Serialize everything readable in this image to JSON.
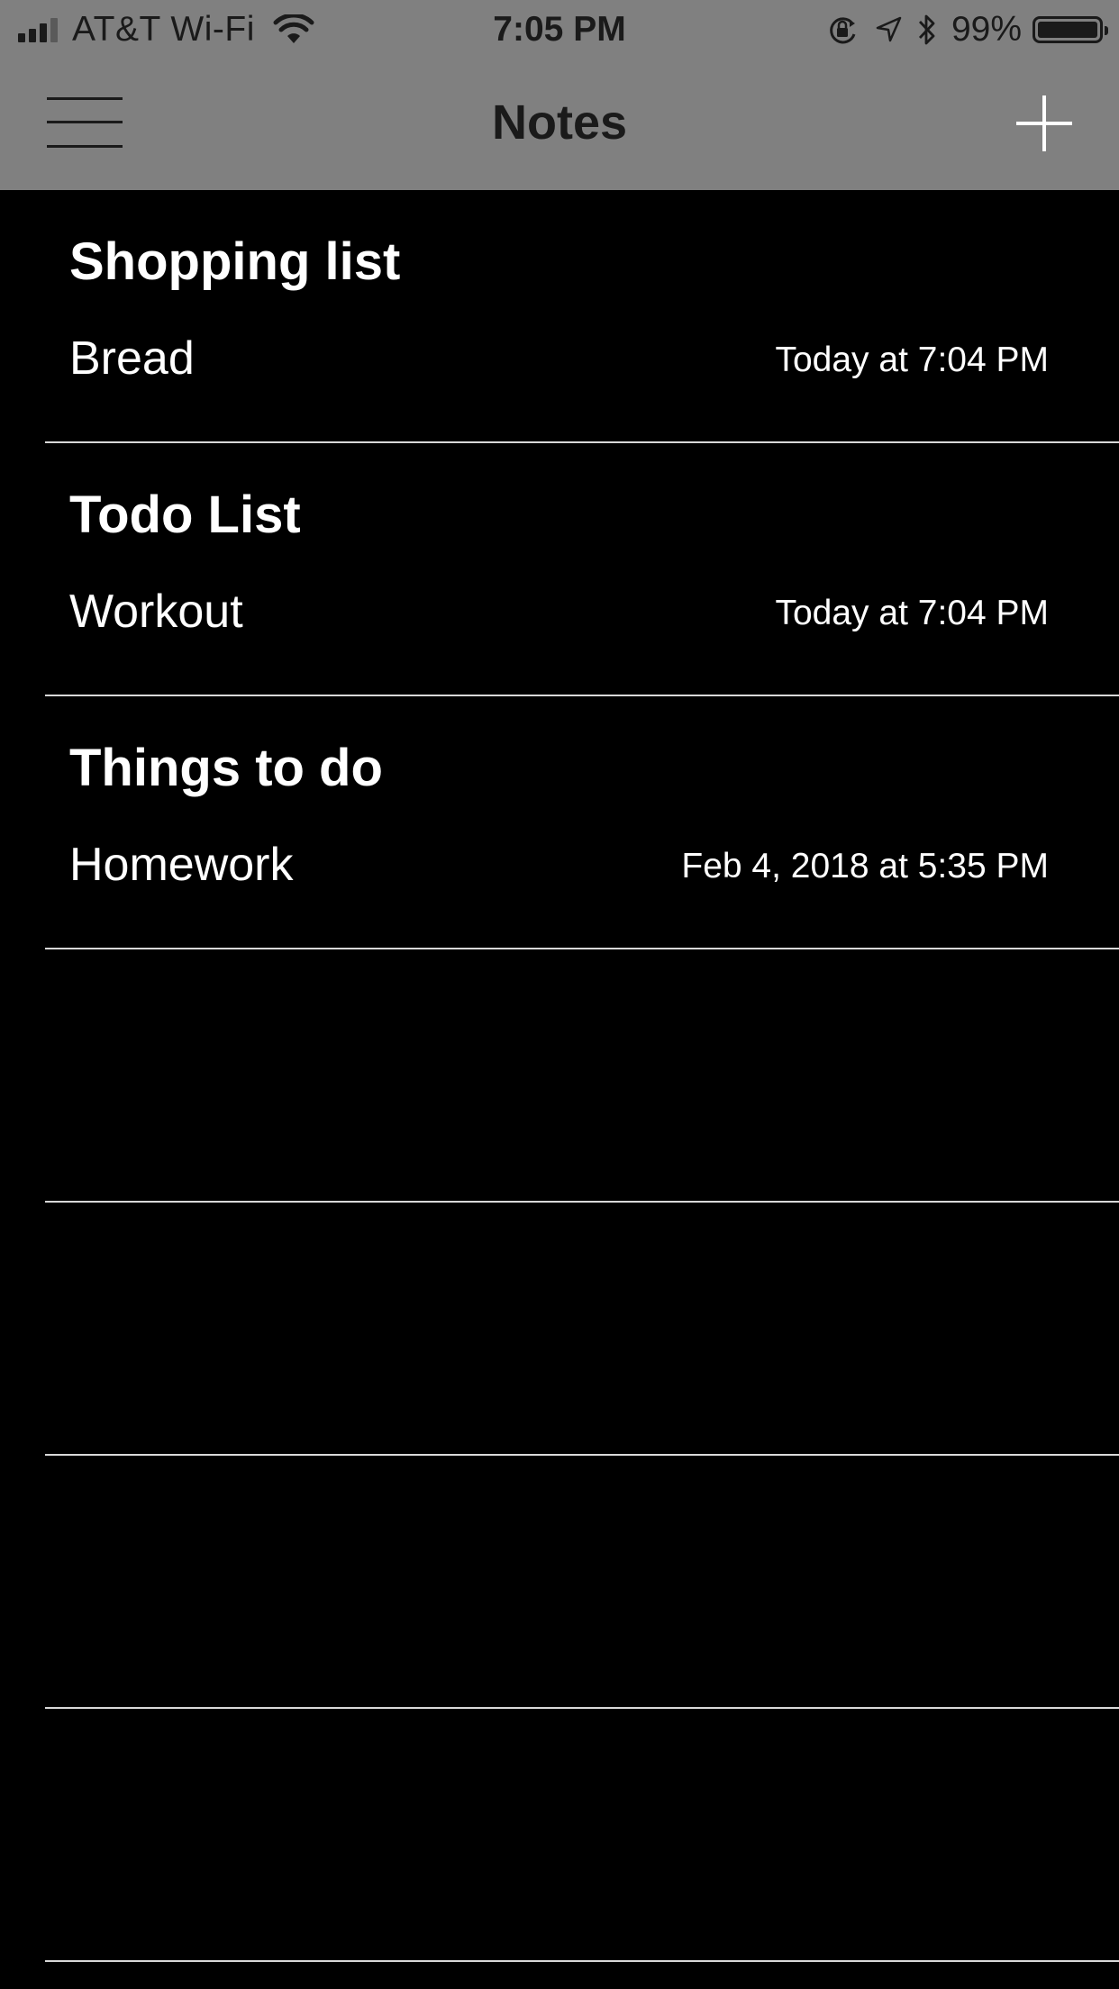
{
  "status_bar": {
    "carrier": "AT&T Wi-Fi",
    "time": "7:05 PM",
    "battery_percent": "99%",
    "icons": [
      "signal-bars-icon",
      "wifi-icon",
      "orientation-lock-icon",
      "location-arrow-icon",
      "bluetooth-icon",
      "battery-icon"
    ]
  },
  "nav": {
    "title": "Notes",
    "menu_icon": "hamburger-menu-icon",
    "add_icon": "plus-icon"
  },
  "notes": [
    {
      "title": "Shopping list",
      "preview": "Bread",
      "date": "Today at 7:04 PM"
    },
    {
      "title": "Todo List",
      "preview": "Workout",
      "date": "Today at 7:04 PM"
    },
    {
      "title": "Things to do",
      "preview": "Homework",
      "date": "Feb 4, 2018 at 5:35 PM"
    }
  ],
  "colors": {
    "header_background": "#808080",
    "list_background": "#000000",
    "text_primary": "#ffffff",
    "header_text": "#1a1a1a",
    "divider": "#d8d8d8"
  }
}
